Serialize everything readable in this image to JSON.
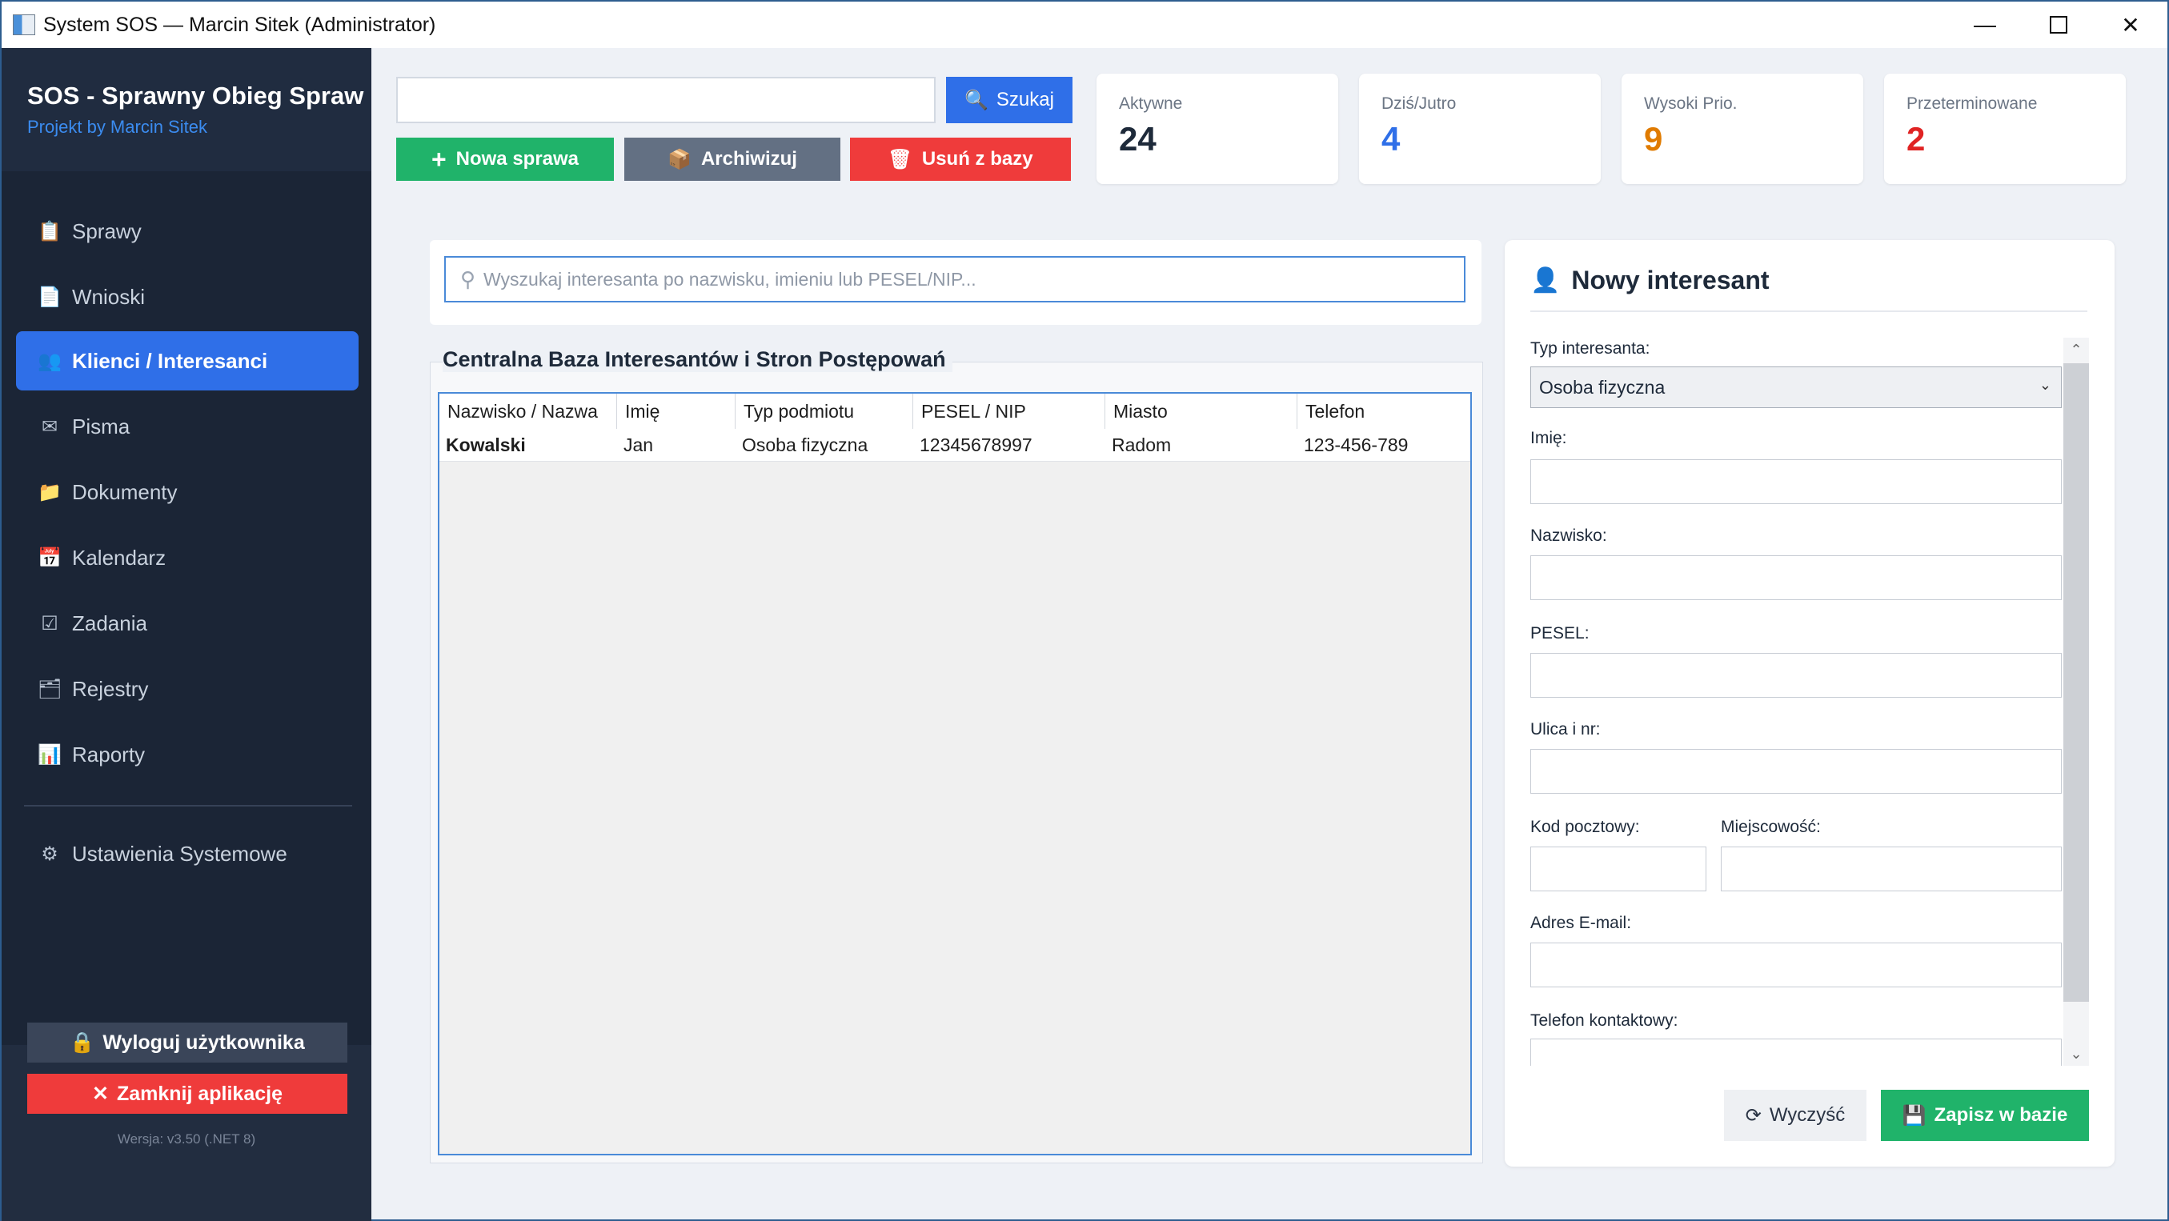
{
  "window": {
    "title": "System SOS — Marcin Sitek (Administrator)",
    "controls": [
      "minimize-icon",
      "maximize-icon",
      "close-icon"
    ]
  },
  "sidebar": {
    "brand_name": "SOS - Sprawny Obieg Spraw",
    "brand_sub": "Projekt by Marcin Sitek",
    "items": [
      {
        "label": "Sprawy",
        "icon": "document-icon"
      },
      {
        "label": "Wnioski",
        "icon": "file-icon"
      },
      {
        "label": "Klienci / Interesanci",
        "icon": "users-icon",
        "active": true
      },
      {
        "label": "Pisma",
        "icon": "envelope-icon"
      },
      {
        "label": "Dokumenty",
        "icon": "folder-icon"
      },
      {
        "label": "Kalendarz",
        "icon": "calendar-icon"
      },
      {
        "label": "Zadania",
        "icon": "checkbox-icon"
      },
      {
        "label": "Rejestry",
        "icon": "register-icon"
      },
      {
        "label": "Raporty",
        "icon": "chart-icon"
      }
    ],
    "settings_label": "Ustawienia Systemowe",
    "logout_label": "Wyloguj użytkownika",
    "close_label": "Zamknij aplikację",
    "version": "Wersja: v3.50 (.NET 8)",
    "accent": "#2f6fe8"
  },
  "toolbar": {
    "search_value": "",
    "search_button": "Szukaj",
    "new_case": "Nowa sprawa",
    "archive": "Archiwizuj",
    "delete": "Usuń z bazy"
  },
  "stats": [
    {
      "label": "Aktywne",
      "value": "24",
      "color": "#1e2a3a"
    },
    {
      "label": "Dziś/Jutro",
      "value": "4",
      "color": "#2f6fe8"
    },
    {
      "label": "Wysoki Prio.",
      "value": "9",
      "color": "#e07b00"
    },
    {
      "label": "Przeterminowane",
      "value": "2",
      "color": "#e02424"
    }
  ],
  "clients": {
    "search_placeholder": "Wyszukaj interesanta po nazwisku, imieniu lub PESEL/NIP...",
    "grid_title": "Centralna Baza Interesantów i Stron Postępowań",
    "columns": [
      "Nazwisko / Nazwa",
      "Imię",
      "Typ podmiotu",
      "PESEL / NIP",
      "Miasto",
      "Telefon"
    ],
    "rows": [
      [
        "Kowalski",
        "Jan",
        "Osoba fizyczna",
        "12345678997",
        "Radom",
        "123-456-789"
      ]
    ]
  },
  "form": {
    "title": "Nowy interesant",
    "type_label": "Typ interesanta:",
    "type_value": "Osoba fizyczna",
    "first_name_label": "Imię:",
    "last_name_label": "Nazwisko:",
    "pesel_label": "PESEL:",
    "street_label": "Ulica i nr:",
    "postcode_label": "Kod pocztowy:",
    "city_label": "Miejscowość:",
    "email_label": "Adres E-mail:",
    "phone_label": "Telefon kontaktowy:",
    "clear_button": "Wyczyść",
    "save_button": "Zapisz w bazie"
  }
}
